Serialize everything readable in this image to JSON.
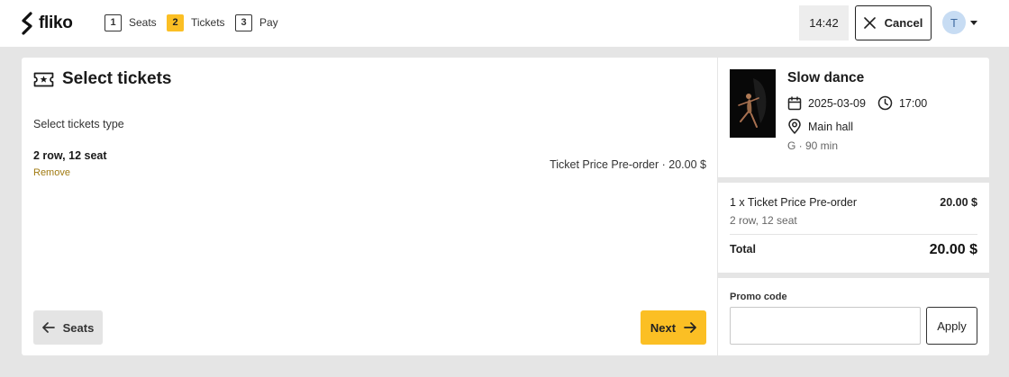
{
  "header": {
    "logo_text": "fliko",
    "steps": [
      {
        "num": "1",
        "label": "Seats"
      },
      {
        "num": "2",
        "label": "Tickets"
      },
      {
        "num": "3",
        "label": "Pay"
      }
    ],
    "active_step": 2,
    "timer": "14:42",
    "cancel_label": "Cancel",
    "avatar_initial": "T"
  },
  "main": {
    "title": "Select tickets",
    "subtitle": "Select tickets type",
    "seat_label": "2 row, 12 seat",
    "remove_label": "Remove",
    "ticket_price": "Ticket Price Pre-order · 20.00 $",
    "back_label": "Seats",
    "next_label": "Next"
  },
  "event": {
    "title": "Slow dance",
    "date": "2025-03-09",
    "time": "17:00",
    "venue": "Main hall",
    "rating_duration": "G · 90 min"
  },
  "summary": {
    "line_label": "1 x Ticket Price Pre-order",
    "line_price": "20.00 $",
    "seat": "2 row, 12 seat",
    "total_label": "Total",
    "total_value": "20.00 $"
  },
  "promo": {
    "label": "Promo code",
    "value": "",
    "placeholder": "",
    "apply_label": "Apply"
  },
  "colors": {
    "accent": "#fbbf24",
    "link": "#a07a10",
    "background": "#e5e5e5"
  }
}
